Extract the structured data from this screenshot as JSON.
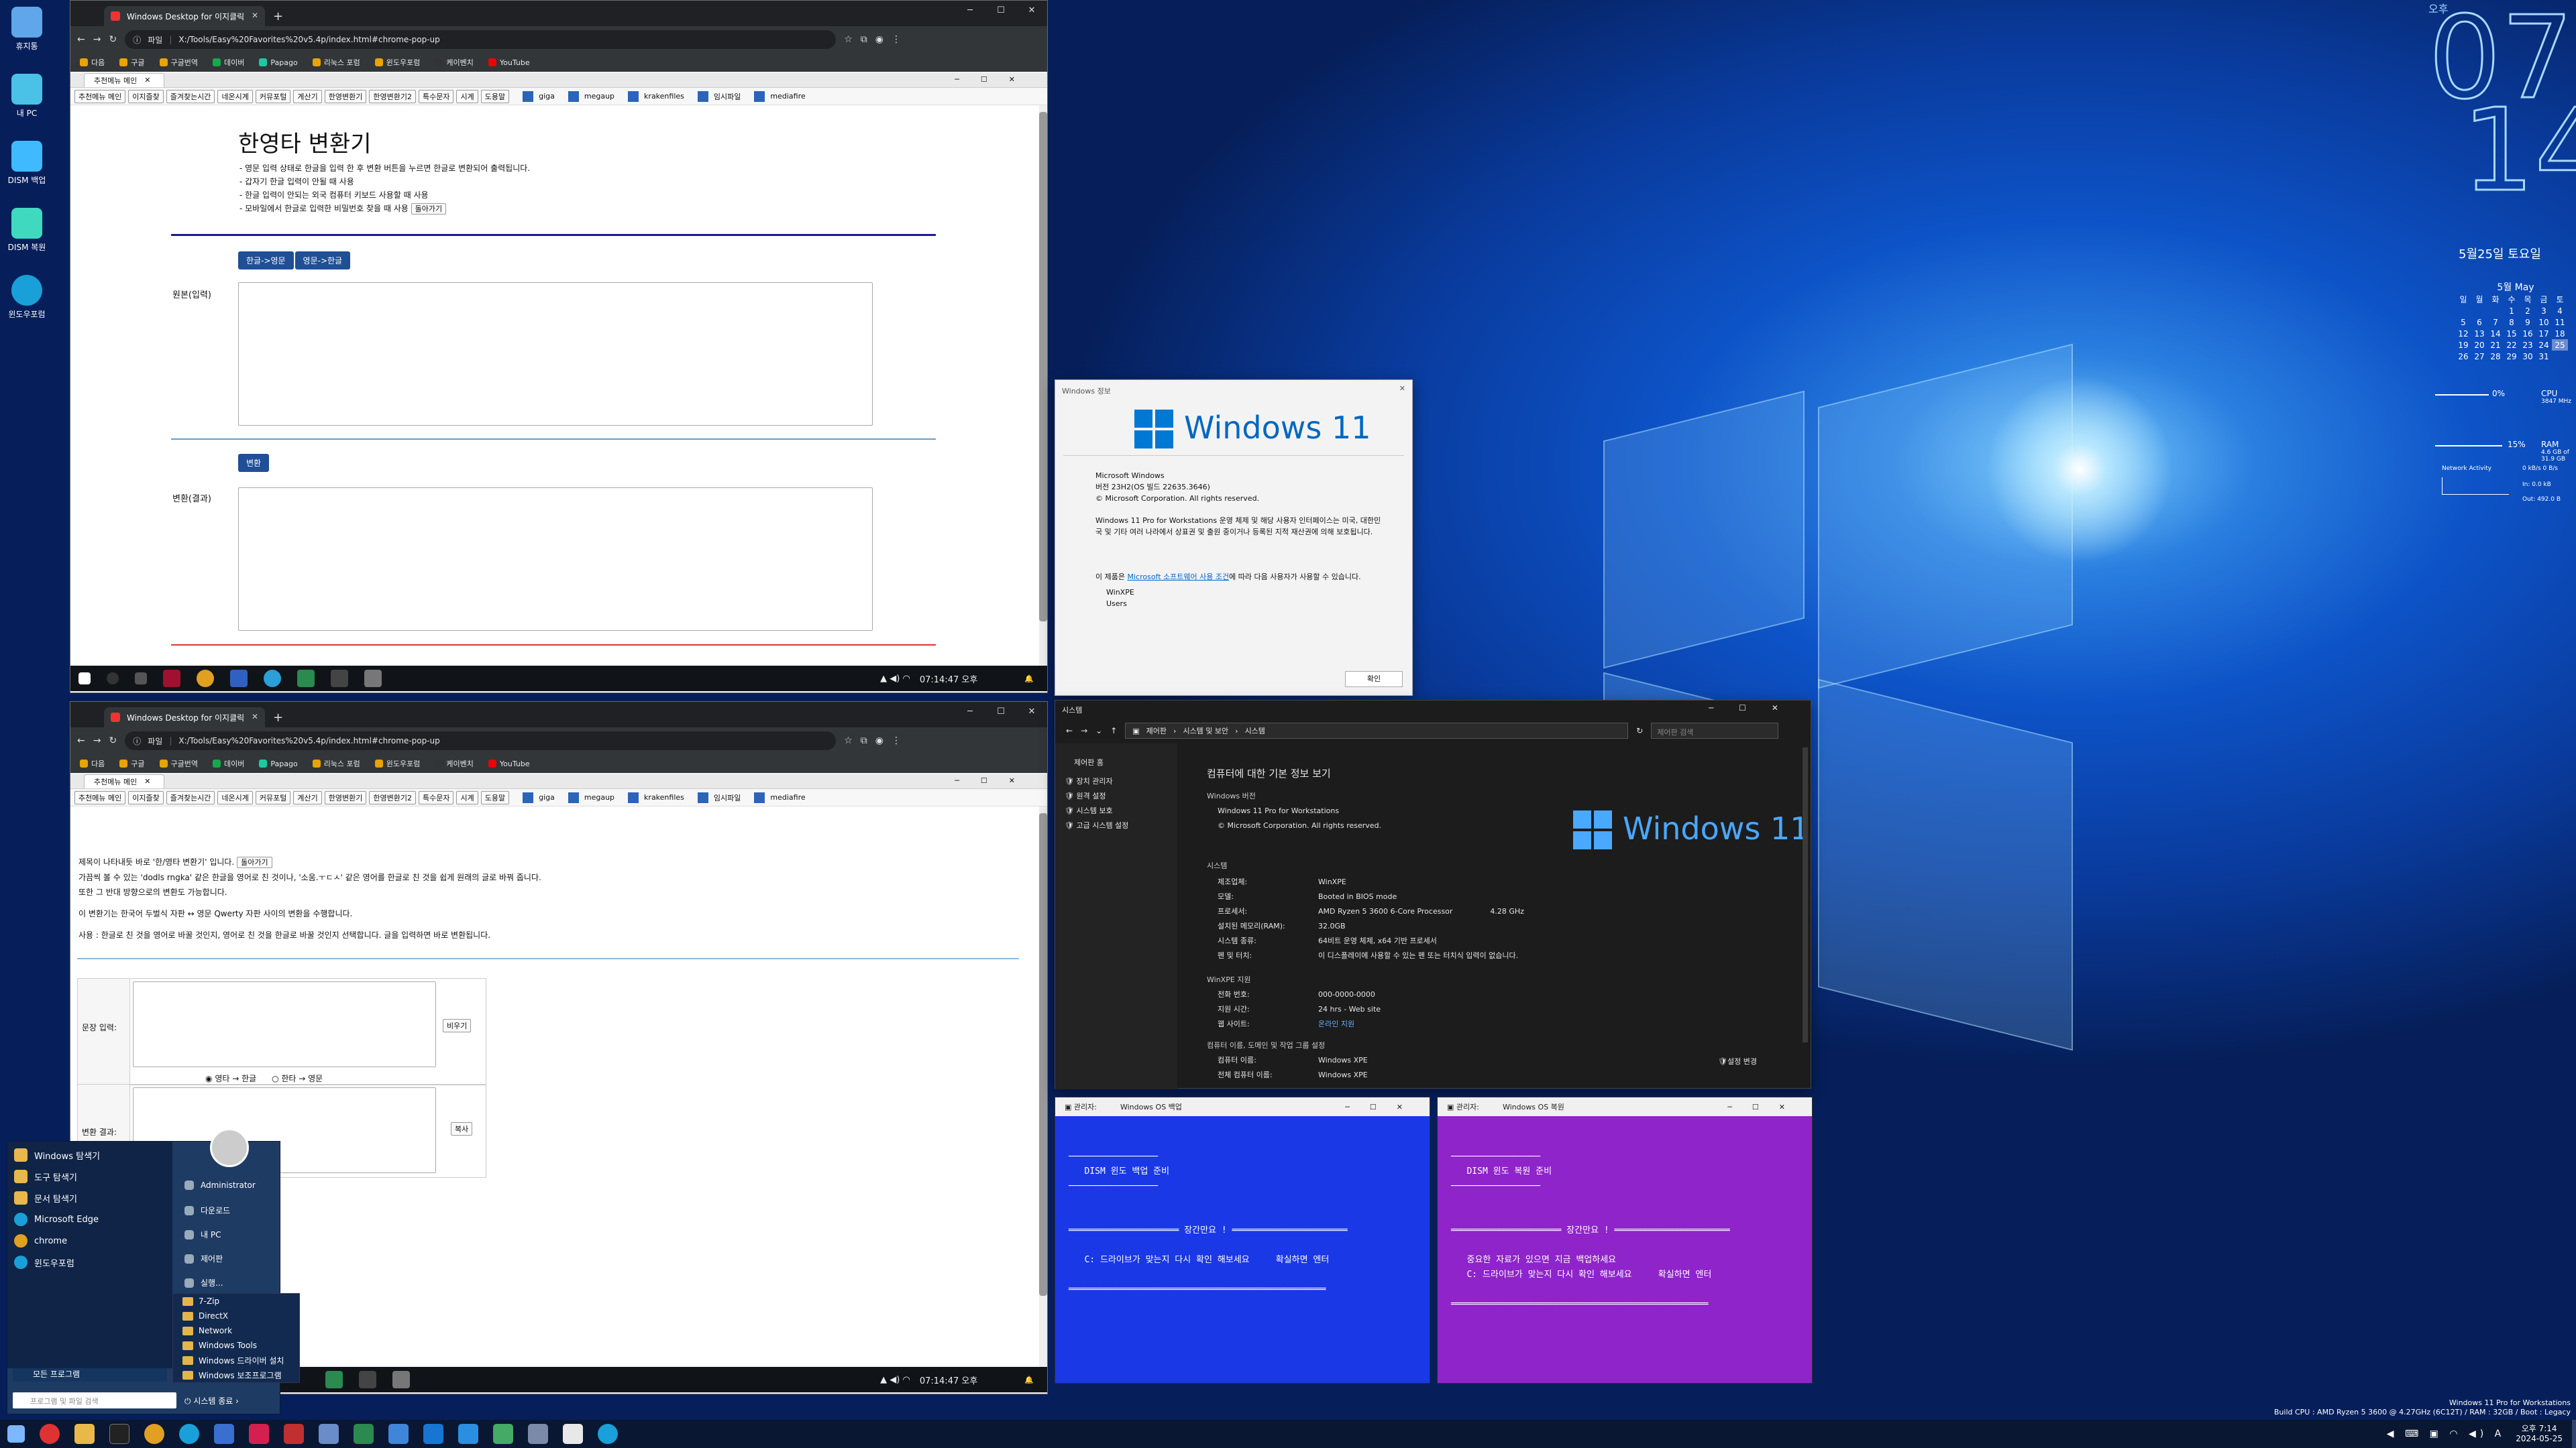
{
  "colors": {
    "desktop": "#0d53c8",
    "browser_chrome": "#202124",
    "cmd_left": "#1a38e6",
    "cmd_right": "#8e24c9",
    "navy_button": "#1f4f96"
  },
  "desktop_icons": [
    {
      "label": "휴지통",
      "icon": "recycle-bin-icon"
    },
    {
      "label": "내 PC",
      "icon": "pc-icon"
    },
    {
      "label": "DISM 백업",
      "icon": "dism-backup-icon"
    },
    {
      "label": "DISM 복원",
      "icon": "dism-restore-icon"
    },
    {
      "label": "윈도우포럼",
      "icon": "edge-icon"
    }
  ],
  "clock": {
    "ampm": "오후",
    "hour": "07",
    "minute": "14",
    "date": "5월25일 토요일",
    "month_title": "5월 May",
    "weekdays": [
      "일",
      "월",
      "화",
      "수",
      "목",
      "금",
      "토"
    ],
    "weeks": [
      [
        "",
        "",
        "",
        "1",
        "2",
        "3",
        "4"
      ],
      [
        "5",
        "6",
        "7",
        "8",
        "9",
        "10",
        "11"
      ],
      [
        "12",
        "13",
        "14",
        "15",
        "16",
        "17",
        "18"
      ],
      [
        "19",
        "20",
        "21",
        "22",
        "23",
        "24",
        "25"
      ],
      [
        "26",
        "27",
        "28",
        "29",
        "30",
        "31",
        ""
      ]
    ]
  },
  "meters": {
    "cpu_pct": "0%",
    "cpu_label": "CPU",
    "cpu_speed": "3847 MHz",
    "ram_pct": "15%",
    "ram_label": "RAM",
    "ram_detail": "4.6 GB of 31.9 GB",
    "net_label": "Network Activity",
    "net_in": "In: 0.0 kB",
    "net_out": "Out: 492.0 B",
    "net_rate": "0 kB/s 0 B/s"
  },
  "browser": {
    "tab_title": "Windows Desktop for 이지클릭",
    "url_label": "파일",
    "url": "X:/Tools/Easy%20Favorites%20v5.4p/index.html#chrome-pop-up",
    "bookmarks": [
      "다음",
      "구글",
      "구글번역",
      "데이버",
      "Papago",
      "리눅스 포럼",
      "윈도우포럼",
      "케이벤치",
      "YouTube"
    ],
    "inner_tab": "추천메뉴 메인",
    "nav_buttons": [
      "추천메뉴 메인",
      "이지즐찾",
      "즐겨찾는시간",
      "네온시계",
      "커뮤포털",
      "계산기",
      "한영변환기",
      "한영변환기2",
      "특수문자",
      "시계",
      "도용말"
    ],
    "links": [
      "giga",
      "megaup",
      "krakenfiles",
      "임시파일",
      "mediafire"
    ]
  },
  "top_page": {
    "title": "한영타 변환기",
    "bullets": [
      "- 영문 입력 상태로 한글을 입력 한 후 변환 버튼을 누르면 한글로 변환되어 출력됩니다.",
      "- 갑자기 한글 입력이 안될 때 사용",
      "- 한글 입력이 안되는 외국 컴퓨터 키보드 사용할 때 사용",
      "- 모바일에서 한글로 입력한 비밀번호 찾을 때 사용"
    ],
    "back_button": "돌아가기",
    "mode_btn1": "한글->영문",
    "mode_btn2": "영문->한글",
    "input_label": "원본(입력)",
    "convert_btn": "변환",
    "output_label": "변환(결과)"
  },
  "bottom_page": {
    "line1": "제목이 나타내듯 바로 '한/영타 변환기' 입니다.",
    "back_button": "돌아가기",
    "line2": "가끔씩 볼 수 있는 'dodls rngka' 같은 한글을 영어로 친 것이나, '소움.ㅜㄷㅅ' 같은 영어를 한글로 친 것을 쉽게 원래의 글로 바꿔 줍니다.",
    "line3": "또한 그 반대 방향으로의 변환도 가능합니다.",
    "line4": "이 변환기는 한국어 두벌식 자판 ↔ 영문 Qwerty 자판 사이의 변환을 수행합니다.",
    "line5": "사용 : 한글로 친 것을 영어로 바꿀 것인지, 영어로 친 것을 한글로 바꿀 것인지 선택합니다. 글을 입력하면 바로 변환됩니다.",
    "input_label": "문장 입력:",
    "clear_btn": "비우기",
    "radio1": "영타 → 한글",
    "radio2": "한타 → 영문",
    "result_label": "변환 결과:",
    "copy_btn": "복사"
  },
  "mini_taskbar": {
    "time": "07:14:47 오후"
  },
  "about": {
    "title": "Windows 정보",
    "logo": "Windows 11",
    "os": "Microsoft Windows",
    "version": "버전 23H2(OS 빌드 22635.3646)",
    "copyright": "© Microsoft Corporation. All rights reserved.",
    "desc": "Windows 11 Pro for Workstations 운영 체제 및 해당 사용자 인터페이스는 미국, 대한민국 및 기타 여러 나라에서 상표권 및 출원 중이거나 등록된 지적 재산권에 의해 보호됩니다.",
    "license_pre": "이 제품은 ",
    "license_link": "Microsoft 소프트웨어 사용 조건",
    "license_post": "에 따라 다음 사용자가 사용할 수 있습니다.",
    "user1": "WinXPE",
    "user2": "Users",
    "ok": "확인"
  },
  "sysinfo": {
    "title": "시스템",
    "breadcrumb": [
      "제어판",
      "시스템 및 보안",
      "시스템"
    ],
    "search_placeholder": "제어판 검색",
    "side_links": [
      "제어판 홈",
      "장치 관리자",
      "원격 설정",
      "시스템 보호",
      "고급 시스템 설정"
    ],
    "heading": "컴퓨터에 대한 기본 정보 보기",
    "edition_h": "Windows 버전",
    "edition": "Windows 11 Pro for Workstations",
    "copyright": "© Microsoft Corporation. All rights reserved.",
    "logo": "Windows 11",
    "system_h": "시스템",
    "rows": [
      [
        "제조업체:",
        "WinXPE"
      ],
      [
        "모델:",
        "Booted in BIOS mode"
      ],
      [
        "프로세서:",
        "AMD Ryzen 5 3600 6-Core Processor                4.28 GHz"
      ],
      [
        "설치된 메모리(RAM):",
        "32.0GB"
      ],
      [
        "시스템 종류:",
        "64비트 운영 체제, x64 기반 프로세서"
      ],
      [
        "펜 및 터치:",
        "이 디스플레이에 사용할 수 있는 펜 또는 터치식 입력이 없습니다."
      ]
    ],
    "support_h": "WinXPE 지원",
    "support": [
      [
        "전화 번호:",
        "000-0000-0000"
      ],
      [
        "지원 시간:",
        "24 hrs - Web site"
      ],
      [
        "웹 사이트:",
        "온라인 지원"
      ]
    ],
    "comp_h": "컴퓨터 이름, 도메인 및 작업 그룹 설정",
    "comp": [
      [
        "컴퓨터 이름:",
        "Windows XPE"
      ],
      [
        "전체 컴퓨터 이름:",
        "Windows XPE"
      ]
    ],
    "change": "설정 변경"
  },
  "cmd_left": {
    "title_app": "관리자:",
    "title": "Windows OS 백업",
    "lines": [
      "─────────────────",
      "   DISM 윈도 백업 준비",
      "─────────────────",
      "",
      "",
      "═════════════════════ 장간만요 ! ══════════════════════",
      "",
      "   C: 드라이브가 맞는지 다시 확인 해보세요     확실하면 엔터",
      "",
      "═════════════════════════════════════════════════"
    ]
  },
  "cmd_right": {
    "title_app": "관리자:",
    "title": "Windows OS 복원",
    "lines": [
      "─────────────────",
      "   DISM 윈도 복원 준비",
      "─────────────────",
      "",
      "",
      "═════════════════════ 장간만요 ! ══════════════════════",
      "",
      "   중요한 자료가 있으면 지금 백업하세요",
      "   C: 드라이브가 맞는지 다시 확인 해보세요     확실하면 엔터",
      "",
      "═════════════════════════════════════════════════"
    ]
  },
  "start_menu": {
    "left_items": [
      "Windows 탐색기",
      "도구 탐색기",
      "문서 탐색기",
      "Microsoft Edge",
      "chrome",
      "윈도우포럼"
    ],
    "right_items": [
      "Administrator",
      "다운로드",
      "내 PC",
      "제어판",
      "실행..."
    ],
    "programs": [
      "7-Zip",
      "DirectX",
      "Network",
      "Windows Tools",
      "Windows 드라이버 설치",
      "Windows 보조프로그램"
    ],
    "all_programs": "모든 프로그램",
    "search_placeholder": "프로그램 및 파일 검색",
    "shutdown": "시스템 종료"
  },
  "watermark": {
    "line1": "Windows 11 Pro for Workstations",
    "line2": "Build CPU : AMD Ryzen 5 3600 @ 4.27GHz (6C12T) / RAM : 32GB / Boot : Legacy"
  },
  "taskbar": {
    "time": "오후 7:14",
    "date": "2024-05-25"
  }
}
